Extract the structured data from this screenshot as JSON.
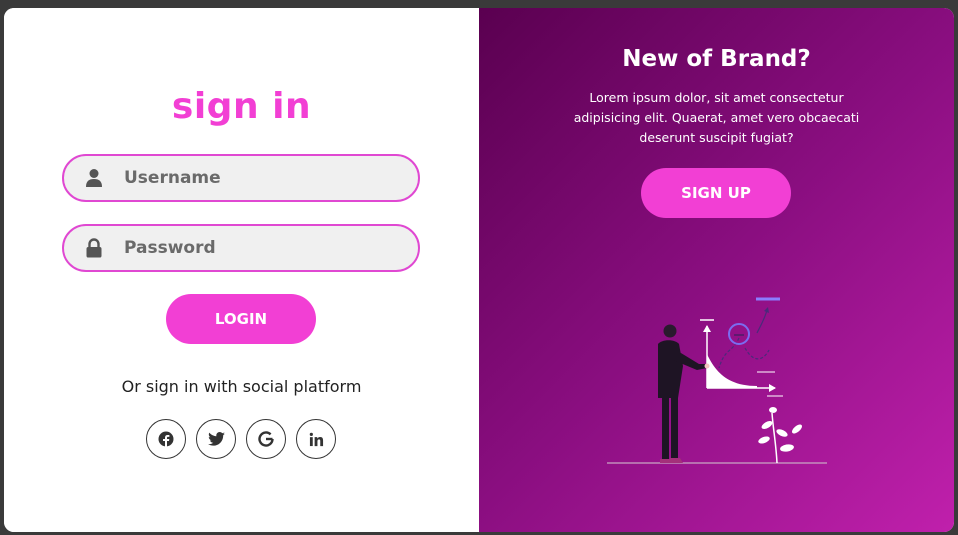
{
  "signin": {
    "title": "sign in",
    "username_placeholder": "Username",
    "password_placeholder": "Password",
    "login_label": "LOGIN",
    "social_text": "Or sign in with social platform",
    "socials": [
      "facebook-icon",
      "twitter-icon",
      "google-icon",
      "linkedin-icon"
    ]
  },
  "panel": {
    "title": "New of Brand?",
    "text": "Lorem ipsum dolor, sit amet consectetur adipisicing elit. Quaerat, amet vero obcaecati deserunt suscipit fugiat?",
    "signup_label": "SIGN UP"
  },
  "colors": {
    "accent": "#f23fd4",
    "panel_gradient_start": "#5a0050",
    "panel_gradient_end": "#c020ac"
  }
}
